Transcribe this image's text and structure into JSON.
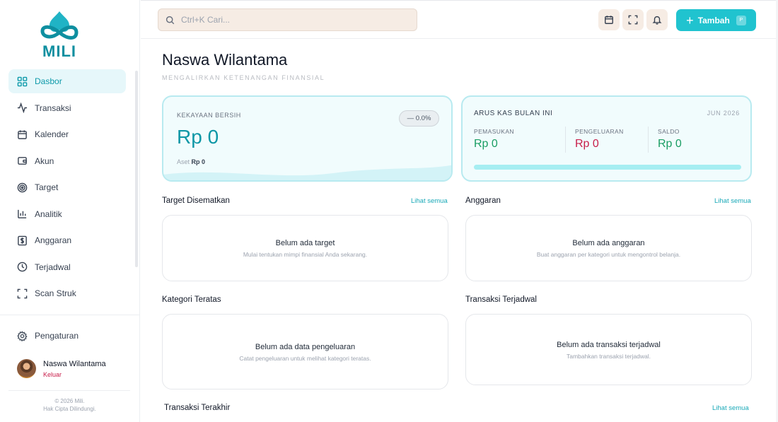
{
  "brand": {
    "name": "MILI"
  },
  "sidebar": {
    "items": [
      {
        "label": "Dasbor",
        "icon": "grid-icon",
        "active": true
      },
      {
        "label": "Transaksi",
        "icon": "activity-icon",
        "active": false
      },
      {
        "label": "Kalender",
        "icon": "calendar-icon",
        "active": false
      },
      {
        "label": "Akun",
        "icon": "wallet-icon",
        "active": false
      },
      {
        "label": "Target",
        "icon": "target-icon",
        "active": false
      },
      {
        "label": "Analitik",
        "icon": "bar-chart-icon",
        "active": false
      },
      {
        "label": "Anggaran",
        "icon": "dollar-icon",
        "active": false
      },
      {
        "label": "Terjadwal",
        "icon": "clock-icon",
        "active": false
      },
      {
        "label": "Scan Struk",
        "icon": "scan-icon",
        "active": false
      }
    ],
    "settings_label": "Pengaturan",
    "user": {
      "name": "Naswa Wilantama",
      "logout_label": "Keluar"
    },
    "copyright_line1": "© 2026 Mili.",
    "copyright_line2": "Hak Cipta Dilindungi."
  },
  "topbar": {
    "search_placeholder": "Ctrl+K Cari...",
    "add_label": "Tambah",
    "add_shortcut": "P"
  },
  "page": {
    "title": "Naswa Wilantama",
    "subtitle": "MENGALIRKAN KETENANGAN FINANSIAL"
  },
  "net_worth": {
    "label": "KEKAYAAN BERSIH",
    "value": "Rp 0",
    "change": "— 0.0%",
    "asset_label": "Aset",
    "asset_value": "Rp 0"
  },
  "cashflow": {
    "label": "ARUS KAS BULAN INI",
    "month": "JUN 2026",
    "income_label": "PEMASUKAN",
    "income_value": "Rp 0",
    "expense_label": "PENGELUARAN",
    "expense_value": "Rp 0",
    "balance_label": "SALDO",
    "balance_value": "Rp 0"
  },
  "sections": {
    "pinned_goals": {
      "title": "Target Disematkan",
      "see_all": "Lihat semua",
      "empty_title": "Belum ada target",
      "empty_desc": "Mulai tentukan mimpi finansial Anda sekarang."
    },
    "budget": {
      "title": "Anggaran",
      "see_all": "Lihat semua",
      "empty_title": "Belum ada anggaran",
      "empty_desc": "Buat anggaran per kategori untuk mengontrol belanja."
    },
    "top_categories": {
      "title": "Kategori Teratas",
      "empty_title": "Belum ada data pengeluaran",
      "empty_desc": "Catat pengeluaran untuk melihat kategori teratas."
    },
    "scheduled": {
      "title": "Transaksi Terjadwal",
      "empty_title": "Belum ada transaksi terjadwal",
      "empty_desc": "Tambahkan transaksi terjadwal."
    },
    "recent": {
      "title": "Transaksi Terakhir",
      "see_all": "Lihat semua"
    }
  },
  "colors": {
    "accent": "#20c3cf",
    "income": "#1a9d63",
    "expense": "#c81e4a"
  }
}
